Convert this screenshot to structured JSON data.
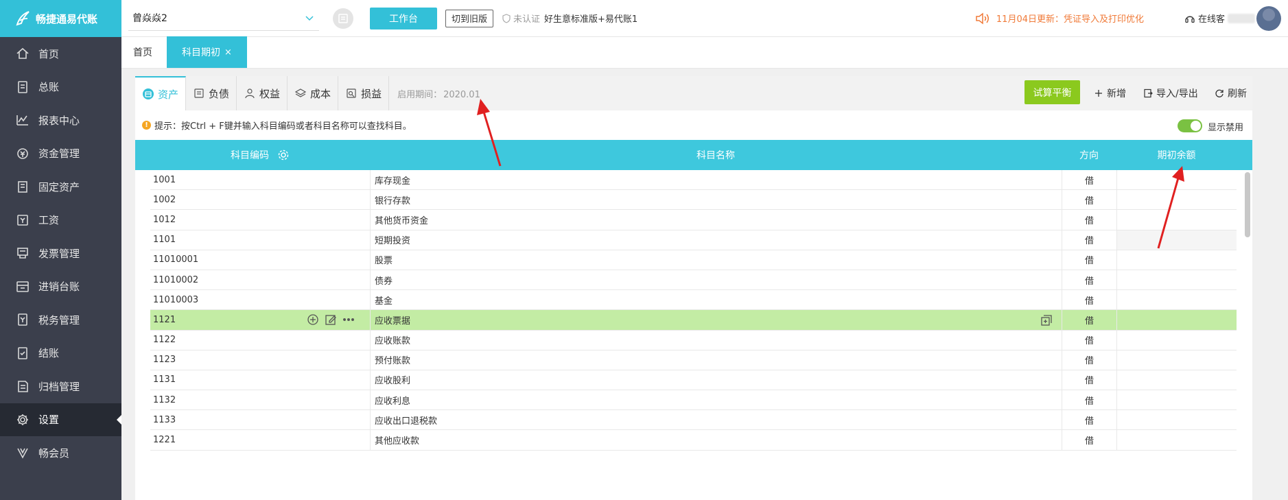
{
  "app": {
    "logo_text": "畅捷通易代账"
  },
  "sidebar": {
    "items": [
      {
        "label": "首页",
        "icon": "home-icon"
      },
      {
        "label": "总账",
        "icon": "ledger-icon"
      },
      {
        "label": "报表中心",
        "icon": "chart-icon"
      },
      {
        "label": "资金管理",
        "icon": "money-icon"
      },
      {
        "label": "固定资产",
        "icon": "building-icon"
      },
      {
        "label": "工资",
        "icon": "salary-icon"
      },
      {
        "label": "发票管理",
        "icon": "invoice-icon"
      },
      {
        "label": "进销台账",
        "icon": "inventory-icon"
      },
      {
        "label": "税务管理",
        "icon": "tax-icon"
      },
      {
        "label": "结账",
        "icon": "checkout-icon"
      },
      {
        "label": "归档管理",
        "icon": "archive-icon"
      },
      {
        "label": "设置",
        "icon": "gear-icon"
      },
      {
        "label": "畅会员",
        "icon": "vip-icon"
      }
    ],
    "active_index": 11
  },
  "topbar": {
    "company": "曾焱焱2",
    "workbench_label": "工作台",
    "old_version_label": "切到旧版",
    "cert_status": "未认证",
    "edition": "好生意标准版+易代账1",
    "notice": "11月04日更新：凭证导入及打印优化",
    "service_label": "在线客"
  },
  "page_tabs": [
    {
      "label": "首页"
    },
    {
      "label": "科目期初",
      "close": "×"
    }
  ],
  "categories": [
    {
      "label": "资产"
    },
    {
      "label": "负债"
    },
    {
      "label": "权益"
    },
    {
      "label": "成本"
    },
    {
      "label": "损益"
    }
  ],
  "period": {
    "label": "启用期间：",
    "value": "2020.01"
  },
  "toolbar": {
    "trial_balance": "试算平衡",
    "add": "新增",
    "import_export": "导入/导出",
    "refresh": "刷新"
  },
  "tip": "提示：按Ctrl + F键并输入科目编码或者科目名称可以查找科目。",
  "toggle_label": "显示禁用",
  "table": {
    "headers": {
      "code": "科目编码",
      "name": "科目名称",
      "direction": "方向",
      "balance": "期初余额"
    },
    "rows": [
      {
        "code": "1001",
        "name": "库存现金",
        "dir": "借"
      },
      {
        "code": "1002",
        "name": "银行存款",
        "dir": "借"
      },
      {
        "code": "1012",
        "name": "其他货币资金",
        "dir": "借"
      },
      {
        "code": "1101",
        "name": "短期投资",
        "dir": "借"
      },
      {
        "code": "11010001",
        "name": "股票",
        "dir": "借"
      },
      {
        "code": "11010002",
        "name": "债券",
        "dir": "借"
      },
      {
        "code": "11010003",
        "name": "基金",
        "dir": "借"
      },
      {
        "code": "1121",
        "name": "应收票据",
        "dir": "借"
      },
      {
        "code": "1122",
        "name": "应收账款",
        "dir": "借"
      },
      {
        "code": "1123",
        "name": "预付账款",
        "dir": "借"
      },
      {
        "code": "1131",
        "name": "应收股利",
        "dir": "借"
      },
      {
        "code": "1132",
        "name": "应收利息",
        "dir": "借"
      },
      {
        "code": "1133",
        "name": "应收出口退税款",
        "dir": "借"
      },
      {
        "code": "1221",
        "name": "其他应收款",
        "dir": "借"
      }
    ],
    "highlight_row": 7
  },
  "colors": {
    "brand": "#33c0d8",
    "sidebar_bg": "#3b3f4c",
    "highlight_row": "#c3eca4",
    "trial_button": "#8bc91e",
    "annotation_arrow": "#e02020"
  }
}
